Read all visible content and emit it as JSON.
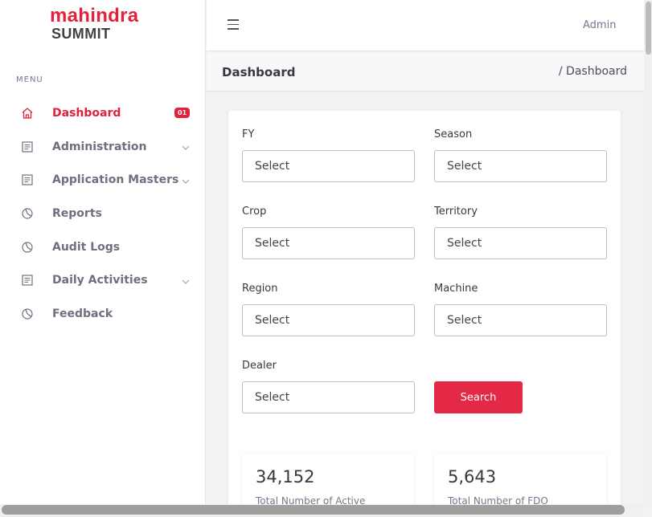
{
  "brand": {
    "name_top": "mahindra",
    "name_bottom": "SUMMIT"
  },
  "sidebar": {
    "menu_title": "MENU",
    "items": [
      {
        "label": "Dashboard",
        "icon": "home-icon",
        "active": true,
        "badge": "01"
      },
      {
        "label": "Administration",
        "icon": "document-icon",
        "expandable": true
      },
      {
        "label": "Application Masters",
        "icon": "document-icon",
        "expandable": true
      },
      {
        "label": "Reports",
        "icon": "pie-chart-icon"
      },
      {
        "label": "Audit Logs",
        "icon": "pie-chart-icon"
      },
      {
        "label": "Daily Activities",
        "icon": "document-icon",
        "expandable": true
      },
      {
        "label": "Feedback",
        "icon": "pie-chart-icon"
      }
    ]
  },
  "header": {
    "user_label": "Admin"
  },
  "page": {
    "title": "Dashboard",
    "breadcrumb": "/ Dashboard"
  },
  "filters": {
    "fy": {
      "label": "FY",
      "value": "Select"
    },
    "season": {
      "label": "Season",
      "value": "Select"
    },
    "crop": {
      "label": "Crop",
      "value": "Select"
    },
    "territory": {
      "label": "Territory",
      "value": "Select"
    },
    "region": {
      "label": "Region",
      "value": "Select"
    },
    "machine": {
      "label": "Machine",
      "value": "Select"
    },
    "dealer": {
      "label": "Dealer",
      "value": "Select"
    },
    "search_label": "Search"
  },
  "stats": [
    {
      "value": "34,152",
      "label": "Total Number of Active"
    },
    {
      "value": "5,643",
      "label": "Total Number of FDO"
    }
  ],
  "colors": {
    "accent": "#e3213a",
    "button": "#e32946"
  }
}
